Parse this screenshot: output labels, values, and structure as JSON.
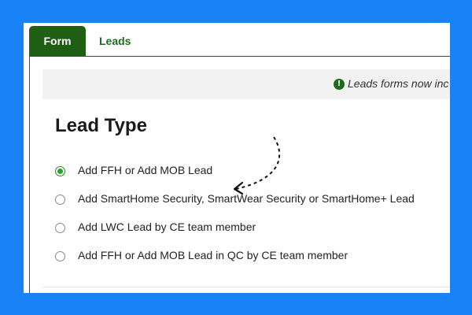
{
  "tabs": [
    {
      "label": "Form",
      "active": true
    },
    {
      "label": "Leads",
      "active": false
    }
  ],
  "notice": {
    "icon": "info-circle-icon",
    "text": "Leads forms now inc"
  },
  "form": {
    "heading": "Lead Type",
    "options": [
      {
        "label": "Add FFH or Add MOB Lead",
        "selected": true
      },
      {
        "label": "Add SmartHome Security, SmartWear Security or SmartHome+ Lead",
        "selected": false
      },
      {
        "label": "Add LWC Lead by CE team member",
        "selected": false
      },
      {
        "label": "Add FFH or Add MOB Lead in QC by CE team member",
        "selected": false
      }
    ]
  },
  "colors": {
    "background": "#1a82f7",
    "accent": "#1f5f14",
    "radio_selected": "#2aa52a"
  }
}
